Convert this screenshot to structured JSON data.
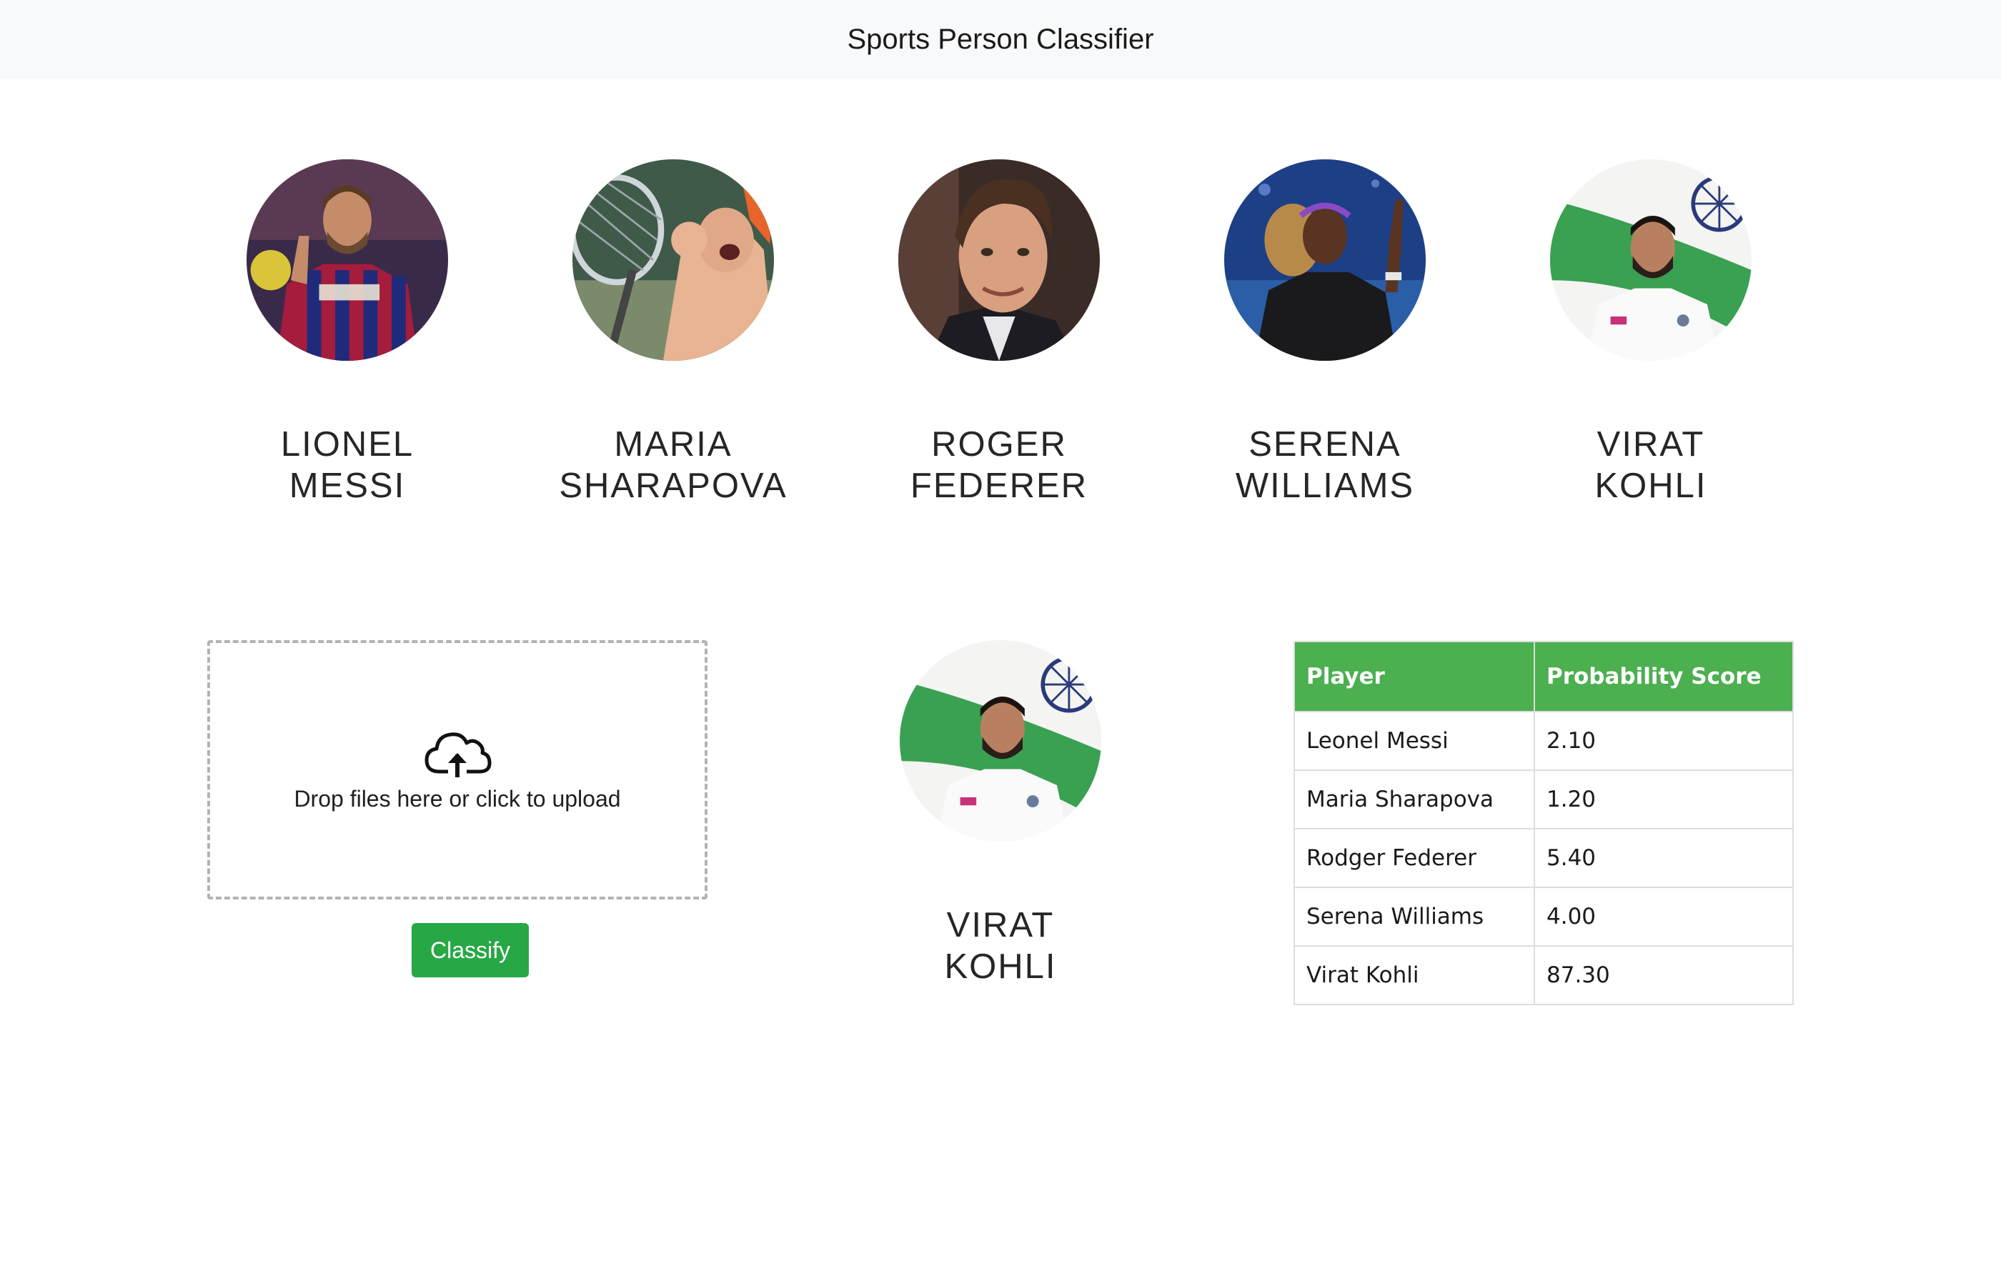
{
  "navbar": {
    "title": "Sports Person Classifier"
  },
  "players": [
    {
      "name": "LIONEL MESSI",
      "photo": "messi-photo"
    },
    {
      "name": "MARIA SHARAPOVA",
      "photo": "sharapova-photo"
    },
    {
      "name": "ROGER FEDERER",
      "photo": "federer-photo"
    },
    {
      "name": "SERENA WILLIAMS",
      "photo": "serena-photo"
    },
    {
      "name": "VIRAT KOHLI",
      "photo": "kohli-photo"
    }
  ],
  "upload": {
    "icon": "cloud-upload-icon",
    "text": "Drop files here or click to upload",
    "button_label": "Classify"
  },
  "result": {
    "name": "VIRAT KOHLI",
    "photo": "kohli-photo"
  },
  "table": {
    "headers": [
      "Player",
      "Probability Score"
    ],
    "rows": [
      {
        "player": "Leonel Messi",
        "score": "2.10"
      },
      {
        "player": "Maria Sharapova",
        "score": "1.20"
      },
      {
        "player": "Rodger Federer",
        "score": "5.40"
      },
      {
        "player": "Serena Williams",
        "score": "4.00"
      },
      {
        "player": "Virat Kohli",
        "score": "87.30"
      }
    ]
  },
  "colors": {
    "navbar_bg": "#f8f9fa",
    "button": "#28a745",
    "table_header": "#4caf50",
    "border": "#dddddd"
  }
}
